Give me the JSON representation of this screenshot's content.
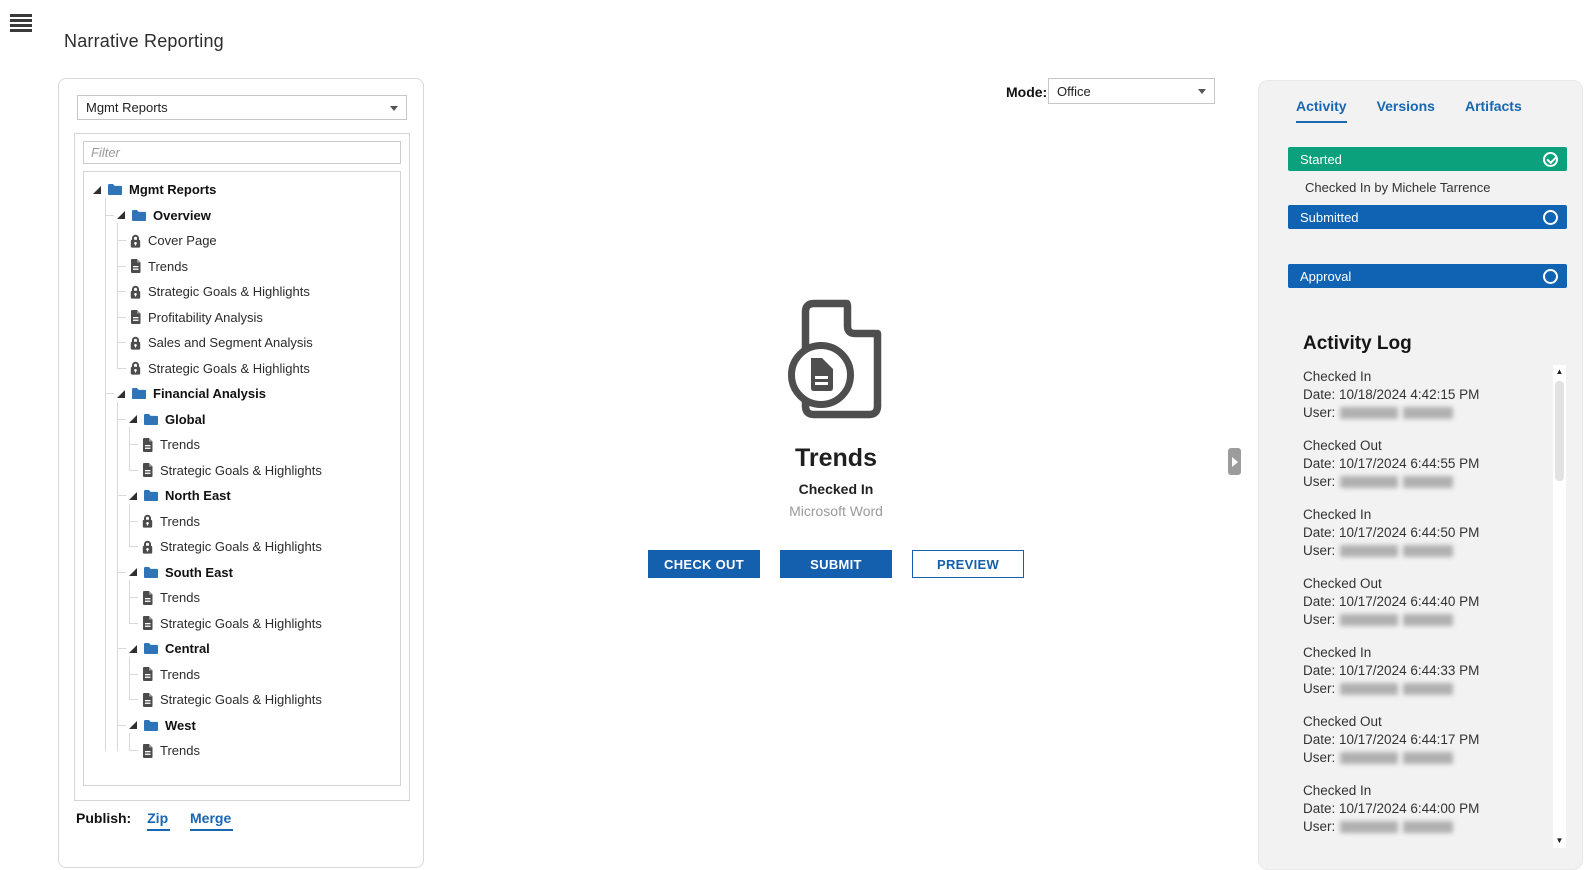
{
  "header": {
    "title": "Narrative Reporting"
  },
  "library": {
    "report_selector": {
      "value": "Mgmt Reports"
    },
    "filter": {
      "placeholder": "Filter"
    },
    "publish": {
      "label": "Publish:",
      "links": [
        "Zip",
        "Merge"
      ]
    },
    "tree": [
      {
        "label": "Mgmt Reports",
        "type": "folder",
        "expanded": true,
        "children": [
          {
            "label": "Overview",
            "type": "folder",
            "expanded": true,
            "children": [
              {
                "label": "Cover Page",
                "type": "locked-doclet"
              },
              {
                "label": "Trends",
                "type": "doclet"
              },
              {
                "label": "Strategic Goals & Highlights",
                "type": "locked-doclet"
              },
              {
                "label": "Profitability Analysis",
                "type": "doclet"
              },
              {
                "label": "Sales and Segment Analysis",
                "type": "locked-doclet"
              },
              {
                "label": "Strategic Goals & Highlights",
                "type": "locked-doclet"
              }
            ]
          },
          {
            "label": "Financial Analysis",
            "type": "folder",
            "expanded": true,
            "children": [
              {
                "label": "Global",
                "type": "folder",
                "expanded": true,
                "children": [
                  {
                    "label": "Trends",
                    "type": "doclet"
                  },
                  {
                    "label": "Strategic Goals & Highlights",
                    "type": "doclet"
                  }
                ]
              },
              {
                "label": "North East",
                "type": "folder",
                "expanded": true,
                "children": [
                  {
                    "label": "Trends",
                    "type": "locked-doclet"
                  },
                  {
                    "label": "Strategic Goals & Highlights",
                    "type": "locked-doclet"
                  }
                ]
              },
              {
                "label": "South East",
                "type": "folder",
                "expanded": true,
                "children": [
                  {
                    "label": "Trends",
                    "type": "doclet"
                  },
                  {
                    "label": "Strategic Goals & Highlights",
                    "type": "doclet"
                  }
                ]
              },
              {
                "label": "Central",
                "type": "folder",
                "expanded": true,
                "children": [
                  {
                    "label": "Trends",
                    "type": "doclet"
                  },
                  {
                    "label": "Strategic Goals & Highlights",
                    "type": "doclet"
                  }
                ]
              },
              {
                "label": "West",
                "type": "folder",
                "expanded": true,
                "children": [
                  {
                    "label": "Trends",
                    "type": "doclet"
                  }
                ]
              }
            ]
          }
        ]
      }
    ]
  },
  "mode": {
    "label": "Mode:",
    "value": "Office"
  },
  "document_panel": {
    "title": "Trends",
    "status": "Checked In",
    "application": "Microsoft Word",
    "buttons": {
      "check_out": "CHECK OUT",
      "submit": "SUBMIT",
      "preview": "PREVIEW"
    }
  },
  "side_panel": {
    "tabs": [
      {
        "label": "Activity",
        "active": true
      },
      {
        "label": "Versions",
        "active": false
      },
      {
        "label": "Artifacts",
        "active": false
      }
    ],
    "workflow": [
      {
        "label": "Started",
        "status": "complete",
        "color": "#0aa17c",
        "note": "Checked In by Michele Tarrence"
      },
      {
        "label": "Submitted",
        "status": "pending",
        "color": "#1063b2",
        "note": ""
      },
      {
        "label": "Approval",
        "status": "pending",
        "color": "#1063b2",
        "note": ""
      }
    ],
    "activity_log": {
      "heading": "Activity Log",
      "date_label": "Date:",
      "user_label": "User:",
      "entries": [
        {
          "action": "Checked In",
          "date": "10/18/2024 4:42:15 PM",
          "user_redacted": true
        },
        {
          "action": "Checked Out",
          "date": "10/17/2024 6:44:55 PM",
          "user_redacted": true
        },
        {
          "action": "Checked In",
          "date": "10/17/2024 6:44:50 PM",
          "user_redacted": true
        },
        {
          "action": "Checked Out",
          "date": "10/17/2024 6:44:40 PM",
          "user_redacted": true
        },
        {
          "action": "Checked In",
          "date": "10/17/2024 6:44:33 PM",
          "user_redacted": true
        },
        {
          "action": "Checked Out",
          "date": "10/17/2024 6:44:17 PM",
          "user_redacted": true
        },
        {
          "action": "Checked In",
          "date": "10/17/2024 6:44:00 PM",
          "user_redacted": true
        }
      ]
    }
  },
  "colors": {
    "primary_blue": "#1460ae",
    "complete_green": "#0aa17c",
    "stage_blue": "#1063b2",
    "folder_blue": "#2e74b6",
    "link_blue": "#1767b3"
  }
}
